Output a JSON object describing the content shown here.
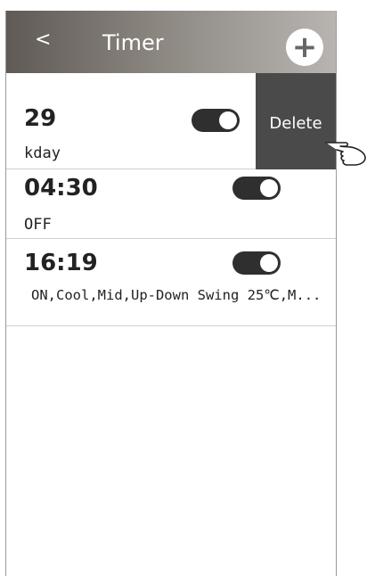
{
  "header": {
    "back_label": "<",
    "title": "Timer",
    "add_label": "+"
  },
  "timers": [
    {
      "time": "29",
      "detail": "kday",
      "enabled": true
    },
    {
      "time": "04:30",
      "detail": "OFF",
      "enabled": true
    },
    {
      "time": "16:19",
      "detail": "ON,Cool,Mid,Up-Down Swing 25℃,M...",
      "enabled": true
    }
  ],
  "swipe_action": {
    "delete_label": "Delete"
  },
  "icons": [
    "add-icon",
    "pointing-hand-icon"
  ]
}
